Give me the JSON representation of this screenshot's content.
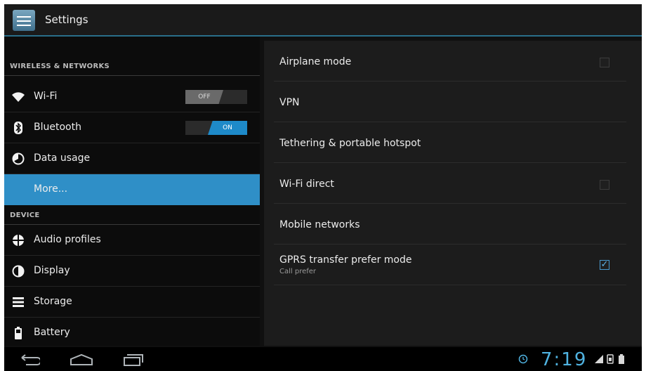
{
  "app": {
    "title": "Settings",
    "icon": "settings-sliders-icon"
  },
  "sidebar": {
    "sections": [
      {
        "header": "WIRELESS & NETWORKS",
        "items": [
          {
            "label": "Wi-Fi",
            "icon": "wifi-icon",
            "toggle": {
              "state": "off",
              "text": "OFF"
            }
          },
          {
            "label": "Bluetooth",
            "icon": "bluetooth-icon",
            "toggle": {
              "state": "on",
              "text": "ON"
            }
          },
          {
            "label": "Data usage",
            "icon": "data-usage-icon"
          },
          {
            "label": "More...",
            "selected": true
          }
        ]
      },
      {
        "header": "DEVICE",
        "items": [
          {
            "label": "Audio profiles",
            "icon": "audio-profiles-icon"
          },
          {
            "label": "Display",
            "icon": "display-icon"
          },
          {
            "label": "Storage",
            "icon": "storage-icon"
          },
          {
            "label": "Battery",
            "icon": "battery-icon"
          }
        ]
      }
    ]
  },
  "detail": {
    "items": [
      {
        "label": "Airplane mode",
        "checkbox": false
      },
      {
        "label": "VPN"
      },
      {
        "label": "Tethering & portable hotspot"
      },
      {
        "label": "Wi-Fi direct",
        "checkbox": false
      },
      {
        "label": "Mobile networks"
      },
      {
        "label": "GPRS transfer prefer mode",
        "sublabel": "Call prefer",
        "checkbox": true
      }
    ]
  },
  "navbar": {
    "buttons": [
      "back-icon",
      "home-icon",
      "recent-apps-icon"
    ],
    "status": {
      "time": "7:19",
      "icons": [
        "alarm-icon",
        "signal-icon",
        "sim-icon",
        "battery-status-icon"
      ]
    }
  },
  "colors": {
    "accent": "#2f8fc7",
    "clock": "#4fb2e0",
    "background": "#101010"
  }
}
